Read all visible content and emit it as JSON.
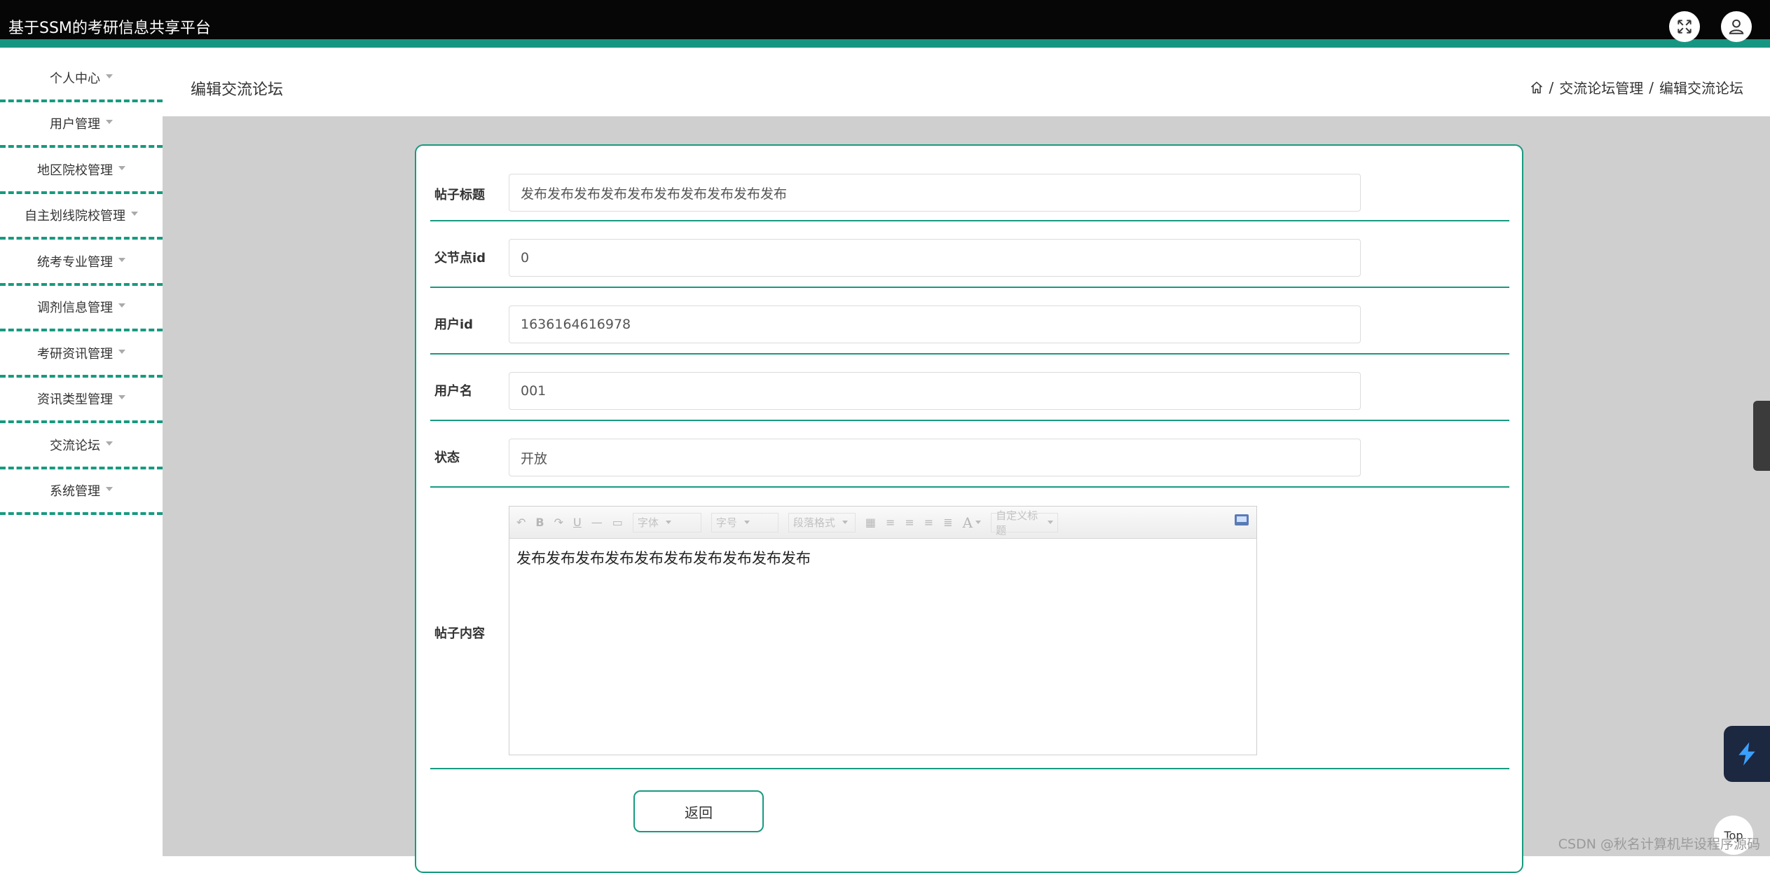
{
  "app": {
    "title": "基于SSM的考研信息共享平台"
  },
  "sidebar": {
    "items": [
      {
        "label": "个人中心"
      },
      {
        "label": "用户管理"
      },
      {
        "label": "地区院校管理"
      },
      {
        "label": "自主划线院校管理"
      },
      {
        "label": "统考专业管理"
      },
      {
        "label": "调剂信息管理"
      },
      {
        "label": "考研资讯管理"
      },
      {
        "label": "资讯类型管理"
      },
      {
        "label": "交流论坛"
      },
      {
        "label": "系统管理"
      }
    ]
  },
  "page": {
    "title": "编辑交流论坛",
    "breadcrumb": [
      "交流论坛管理",
      "编辑交流论坛"
    ],
    "breadcrumb_sep": "/"
  },
  "form": {
    "fields": [
      {
        "label": "帖子标题",
        "value": "发布发布发布发布发布发布发布发布发布发布"
      },
      {
        "label": "父节点id",
        "value": "0"
      },
      {
        "label": "用户id",
        "value": "1636164616978"
      },
      {
        "label": "用户名",
        "value": "001"
      },
      {
        "label": "状态",
        "value": "开放"
      }
    ],
    "content_label": "帖子内容",
    "content_value": "发布发布发布发布发布发布发布发布发布发布",
    "toolbar": {
      "bold": "B",
      "underline": "U",
      "font_family": "字体",
      "font_size": "字号",
      "paragraph": "段落格式",
      "font_color": "A",
      "custom_title": "自定义标题"
    },
    "back_label": "返回"
  },
  "floating": {
    "top_label": "Top",
    "watermark": "CSDN @秋名计算机毕设程序源码"
  },
  "colors": {
    "accent": "#179a80",
    "topbar": "#060606",
    "gray_bg": "#cfcfcf"
  }
}
